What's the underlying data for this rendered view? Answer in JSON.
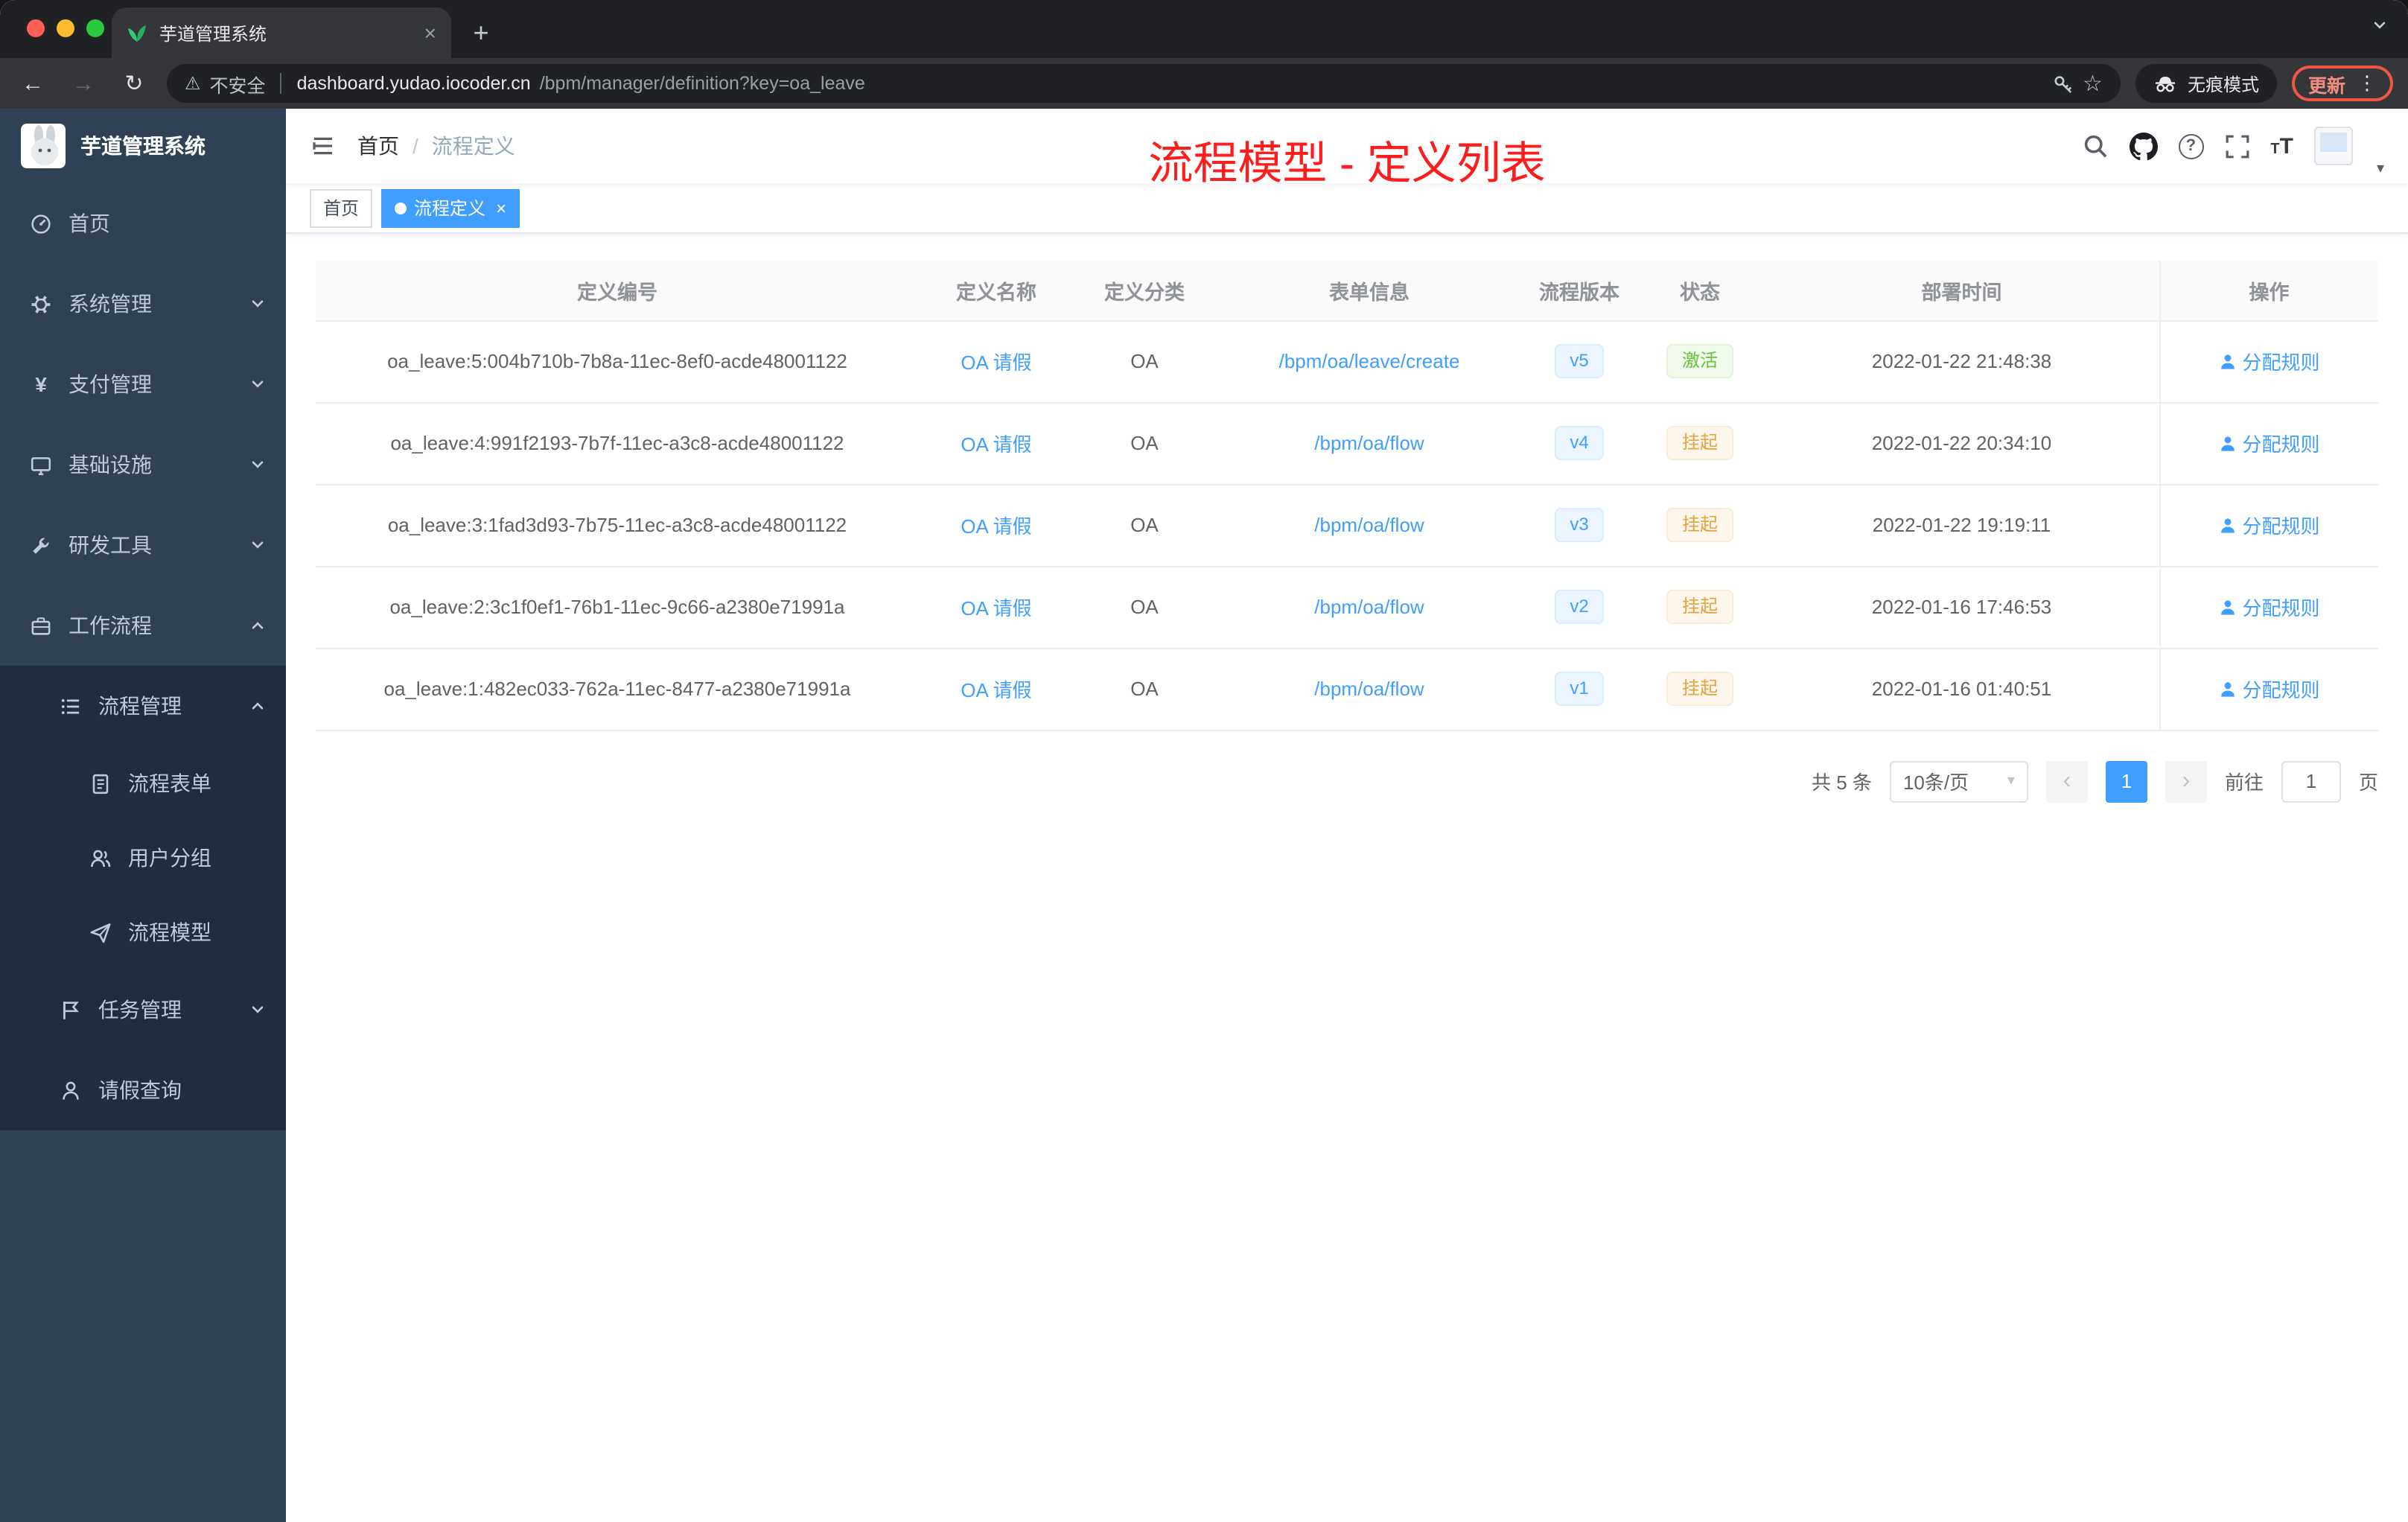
{
  "colors": {
    "accent_blue": "#409eff",
    "success_green": "#67c23a",
    "warning_orange": "#e6a23c",
    "annotation_red": "#ff1c1c",
    "sidebar_bg": "#304156",
    "sidebar_sub_bg": "#1f2d3d"
  },
  "browser": {
    "tab_title": "芋道管理系统",
    "security_label": "不安全",
    "url_host": "dashboard.yudao.iocoder.cn",
    "url_path": "/bpm/manager/definition?key=oa_leave",
    "incognito_label": "无痕模式",
    "update_label": "更新"
  },
  "glyphs": {
    "back": "←",
    "forward": "→",
    "reload": "↻",
    "warning": "⚠",
    "divider": "|",
    "star": "☆",
    "menu": "⋮",
    "close": "×",
    "new_tab": "+",
    "prev": "‹",
    "next": "›",
    "caret": "▾",
    "question": "?",
    "font_small": "T",
    "font_big": "T"
  },
  "sidebar": {
    "app_title": "芋道管理系统",
    "items": [
      {
        "label": "首页"
      },
      {
        "label": "系统管理"
      },
      {
        "label": "支付管理"
      },
      {
        "label": "基础设施"
      },
      {
        "label": "研发工具"
      },
      {
        "label": "工作流程"
      },
      {
        "label": "流程管理"
      },
      {
        "label": "流程表单"
      },
      {
        "label": "用户分组"
      },
      {
        "label": "流程模型"
      },
      {
        "label": "任务管理"
      },
      {
        "label": "请假查询"
      }
    ]
  },
  "navbar": {
    "breadcrumb": [
      "首页",
      "流程定义"
    ],
    "annotation": "流程模型 - 定义列表"
  },
  "tags": [
    {
      "label": "首页"
    },
    {
      "label": "流程定义"
    }
  ],
  "table": {
    "headers": [
      "定义编号",
      "定义名称",
      "定义分类",
      "表单信息",
      "流程版本",
      "状态",
      "部署时间",
      "操作"
    ],
    "rows": [
      {
        "id": "oa_leave:5:004b710b-7b8a-11ec-8ef0-acde48001122",
        "name": "OA 请假",
        "category": "OA",
        "form": "/bpm/oa/leave/create",
        "version": "v5",
        "status": "激活",
        "status_type": "success",
        "deployed": "2022-01-22 21:48:38",
        "action": "分配规则"
      },
      {
        "id": "oa_leave:4:991f2193-7b7f-11ec-a3c8-acde48001122",
        "name": "OA 请假",
        "category": "OA",
        "form": "/bpm/oa/flow",
        "version": "v4",
        "status": "挂起",
        "status_type": "warning",
        "deployed": "2022-01-22 20:34:10",
        "action": "分配规则"
      },
      {
        "id": "oa_leave:3:1fad3d93-7b75-11ec-a3c8-acde48001122",
        "name": "OA 请假",
        "category": "OA",
        "form": "/bpm/oa/flow",
        "version": "v3",
        "status": "挂起",
        "status_type": "warning",
        "deployed": "2022-01-22 19:19:11",
        "action": "分配规则"
      },
      {
        "id": "oa_leave:2:3c1f0ef1-76b1-11ec-9c66-a2380e71991a",
        "name": "OA 请假",
        "category": "OA",
        "form": "/bpm/oa/flow",
        "version": "v2",
        "status": "挂起",
        "status_type": "warning",
        "deployed": "2022-01-16 17:46:53",
        "action": "分配规则"
      },
      {
        "id": "oa_leave:1:482ec033-762a-11ec-8477-a2380e71991a",
        "name": "OA 请假",
        "category": "OA",
        "form": "/bpm/oa/flow",
        "version": "v1",
        "status": "挂起",
        "status_type": "warning",
        "deployed": "2022-01-16 01:40:51",
        "action": "分配规则"
      }
    ]
  },
  "pagination": {
    "total": "共 5 条",
    "page_size": "10条/页",
    "page": "1",
    "goto_label": "前往",
    "goto_value": "1",
    "unit": "页"
  }
}
